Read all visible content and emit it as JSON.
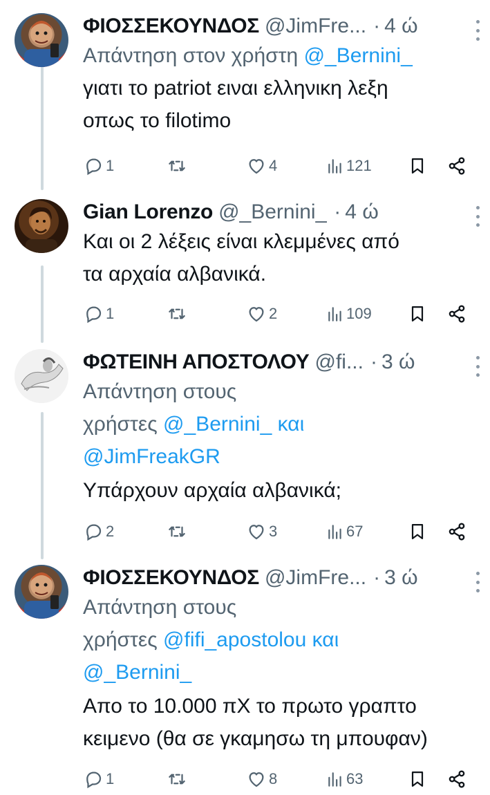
{
  "tweets": [
    {
      "name": "ΦΙΟΣΣΕΚΟΥΝΔΟΣ",
      "handle": "@JimFre...",
      "dot": "·",
      "time": "4 ώ",
      "reply_prefix": "Απάντηση στον χρήστη",
      "reply_mentions": [
        "@_Bernini_"
      ],
      "reply_joiner": "",
      "body_lines": [
        "γιατι το patriot ειναι ελληνικη λεξη",
        "οπως το filotimo"
      ],
      "replies": "1",
      "likes": "4",
      "views": "121"
    },
    {
      "name": "Gian Lorenzo",
      "handle": "@_Bernini_",
      "dot": "·",
      "time": "4 ώ",
      "body_lines": [
        "Και οι 2 λέξεις είναι κλεμμένες από",
        "τα αρχαία αλβανικά."
      ],
      "replies": "1",
      "likes": "2",
      "views": "109"
    },
    {
      "name": "ΦΩΤΕΙΝΗ ΑΠΟΣΤΟΛΟΥ",
      "handle": "@fi...",
      "dot": "·",
      "time": "3 ώ",
      "reply_line1": "Απάντηση στους",
      "reply_line2_prefix": "χρήστες",
      "reply_mentions": [
        "@_Bernini_",
        "@JimFreakGR"
      ],
      "reply_joiner": "και",
      "body_lines": [
        "Υπάρχουν αρχαία αλβανικά;"
      ],
      "replies": "2",
      "likes": "3",
      "views": "67"
    },
    {
      "name": "ΦΙΟΣΣΕΚΟΥΝΔΟΣ",
      "handle": "@JimFre...",
      "dot": "·",
      "time": "3 ώ",
      "reply_line1": "Απάντηση στους",
      "reply_line2_prefix": "χρήστες",
      "reply_mentions": [
        "@fifi_apostolou",
        "@_Bernini_"
      ],
      "reply_joiner": "και",
      "body_lines": [
        "Απο το 10.000 πΧ το πρωτο γραπτο",
        "κειμενο (θα σε γκαμησω τη μπουφαν)"
      ],
      "replies": "1",
      "likes": "8",
      "views": "63"
    }
  ],
  "icons": {
    "reply": "reply-icon",
    "retweet": "retweet-icon",
    "like": "heart-icon",
    "views": "views-icon",
    "bookmark": "bookmark-icon",
    "share": "share-icon",
    "more": "more-icon"
  },
  "colors": {
    "mention": "#1d9bf0",
    "secondary_text": "#536471",
    "thread_line": "#cfd9de"
  }
}
